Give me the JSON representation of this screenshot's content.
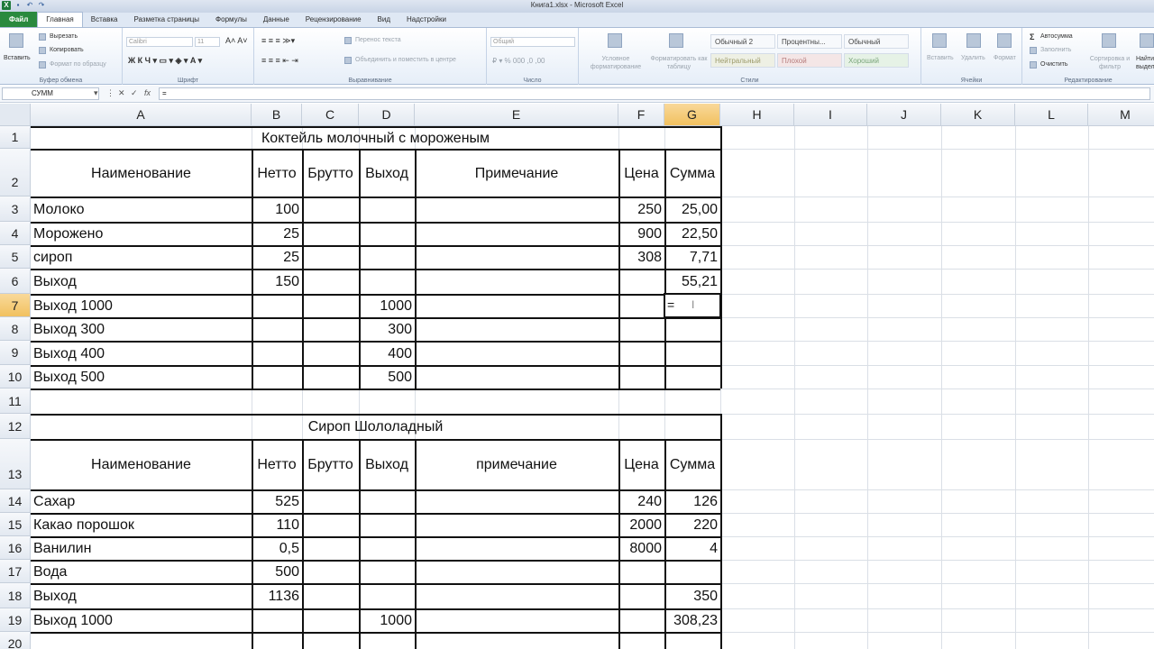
{
  "window": {
    "title": "Книга1.xlsx - Microsoft Excel"
  },
  "tabs": [
    "Файл",
    "Главная",
    "Вставка",
    "Разметка страницы",
    "Формулы",
    "Данные",
    "Рецензирование",
    "Вид",
    "Надстройки"
  ],
  "ribbon": {
    "clipboard": {
      "paste": "Вставить",
      "cut": "Вырезать",
      "copy": "Копировать",
      "painter": "Формат по образцу",
      "label": "Буфер обмена"
    },
    "font": {
      "name": "Calibri",
      "size": "11",
      "label": "Шрифт"
    },
    "alignment": {
      "wrap": "Перенос текста",
      "merge": "Объединить и поместить в центре",
      "label": "Выравнивание"
    },
    "number": {
      "format": "Общий",
      "label": "Число"
    },
    "styles": {
      "cond": "Условное форматирование",
      "table": "Форматировать как таблицу",
      "cells": [
        "Обычный 2",
        "Процентны...",
        "Обычный",
        "Нейтральный",
        "Плохой",
        "Хороший"
      ],
      "label": "Стили"
    },
    "cells": {
      "insert": "Вставить",
      "delete": "Удалить",
      "format": "Формат",
      "label": "Ячейки"
    },
    "editing": {
      "autosum": "Автосумма",
      "fill": "Заполнить",
      "clear": "Очистить",
      "sort": "Сортировка и фильтр",
      "find": "Найти и выделить",
      "label": "Редактирование"
    }
  },
  "formula_bar": {
    "name_box": "СУММ",
    "formula": "="
  },
  "columns": [
    "A",
    "B",
    "C",
    "D",
    "E",
    "F",
    "G",
    "H",
    "I",
    "J",
    "K",
    "L",
    "M"
  ],
  "rows": [
    "1",
    "2",
    "3",
    "4",
    "5",
    "6",
    "7",
    "8",
    "9",
    "10",
    "11",
    "12",
    "13",
    "14",
    "15",
    "16",
    "17",
    "18",
    "19",
    "20"
  ],
  "table1": {
    "title": "Коктейль молочный с мороженым",
    "headers": [
      "Наименование",
      "Нетто",
      "Брутто",
      "Выход",
      "Примечание",
      "Цена",
      "Сумма"
    ],
    "rows": [
      [
        "Молоко",
        "100",
        "",
        "",
        "",
        "250",
        "25,00"
      ],
      [
        "Морожено",
        "25",
        "",
        "",
        "",
        "900",
        "22,50"
      ],
      [
        "сироп",
        "25",
        "",
        "",
        "",
        "308",
        "7,71"
      ],
      [
        "Выход",
        "150",
        "",
        "",
        "",
        "",
        "55,21"
      ],
      [
        "Выход 1000",
        "",
        "",
        "1000",
        "",
        "",
        "="
      ],
      [
        "Выход 300",
        "",
        "",
        "300",
        "",
        "",
        ""
      ],
      [
        "Выход 400",
        "",
        "",
        "400",
        "",
        "",
        ""
      ],
      [
        "Выход 500",
        "",
        "",
        "500",
        "",
        "",
        ""
      ]
    ]
  },
  "table2": {
    "title": "Сироп Шололадный",
    "headers": [
      "Наименование",
      "Нетто",
      "Брутто",
      "Выход",
      "примечание",
      "Цена",
      "Сумма"
    ],
    "rows": [
      [
        "Сахар",
        "525",
        "",
        "",
        "",
        "240",
        "126"
      ],
      [
        "Какао порошок",
        "110",
        "",
        "",
        "",
        "2000",
        "220"
      ],
      [
        "Ванилин",
        "0,5",
        "",
        "",
        "",
        "8000",
        "4"
      ],
      [
        "Вода",
        "500",
        "",
        "",
        "",
        "",
        ""
      ],
      [
        "Выход",
        "1136",
        "",
        "",
        "",
        "",
        "350"
      ],
      [
        "Выход 1000",
        "",
        "",
        "1000",
        "",
        "",
        "308,23"
      ]
    ]
  }
}
